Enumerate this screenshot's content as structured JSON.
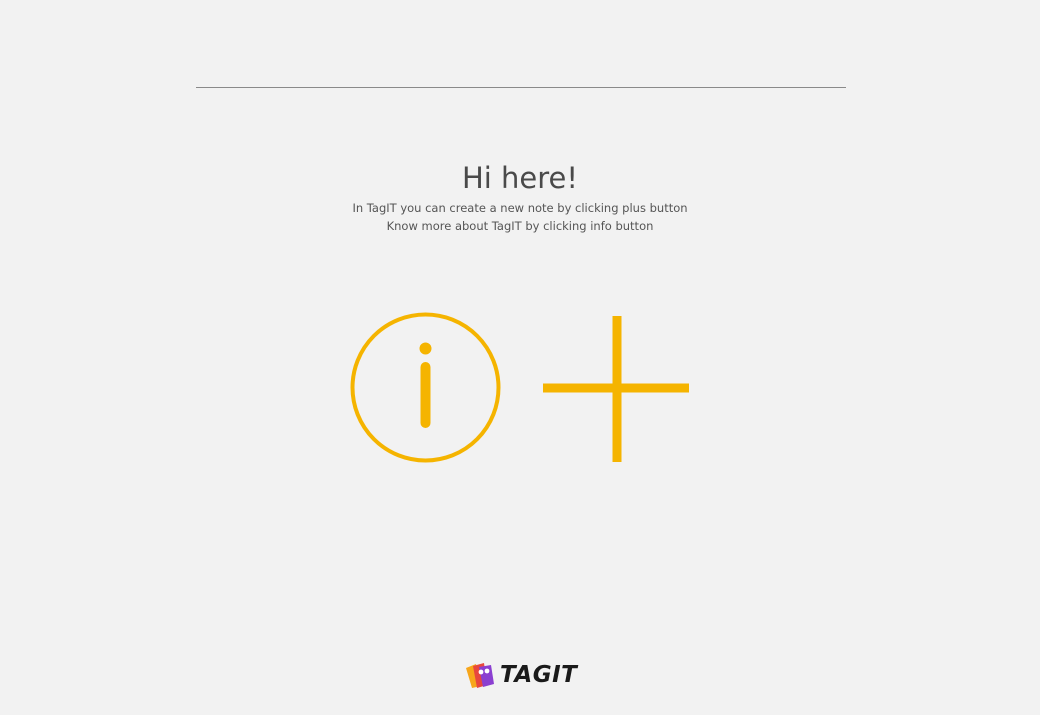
{
  "welcome": {
    "title": "Hi here!",
    "line1": "In TagIT you can create a new note by clicking plus button",
    "line2": "Know more about TagIT by clicking info button"
  },
  "actions": {
    "info_icon": "info-circle-icon",
    "plus_icon": "plus-icon",
    "accent_color": "#f5b400"
  },
  "brand": {
    "name": "TAGIT",
    "logo_icon": "tag-logo-icon"
  }
}
